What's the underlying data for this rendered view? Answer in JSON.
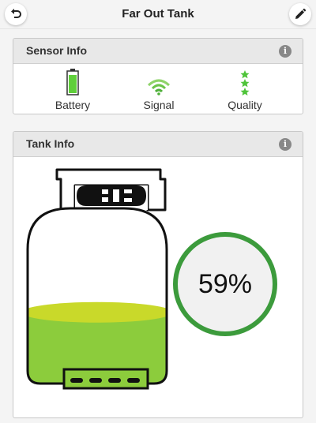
{
  "header": {
    "title": "Far Out Tank",
    "back_icon": "undo-arrow-icon",
    "edit_icon": "pencil-icon"
  },
  "sensor_info": {
    "title": "Sensor Info",
    "info_icon": "info-icon",
    "items": [
      {
        "label": "Battery",
        "icon": "battery-icon"
      },
      {
        "label": "Signal",
        "icon": "wifi-signal-icon"
      },
      {
        "label": "Quality",
        "icon": "stars-icon"
      }
    ]
  },
  "tank_info": {
    "title": "Tank Info",
    "info_icon": "info-icon",
    "level_percent_text": "59%",
    "level_fraction": 0.59
  },
  "colors": {
    "accent_green": "#3c9b3c",
    "liquid_green": "#8ccc3c",
    "liquid_surface": "#c9d92a",
    "icon_green": "#5fcf3a"
  }
}
